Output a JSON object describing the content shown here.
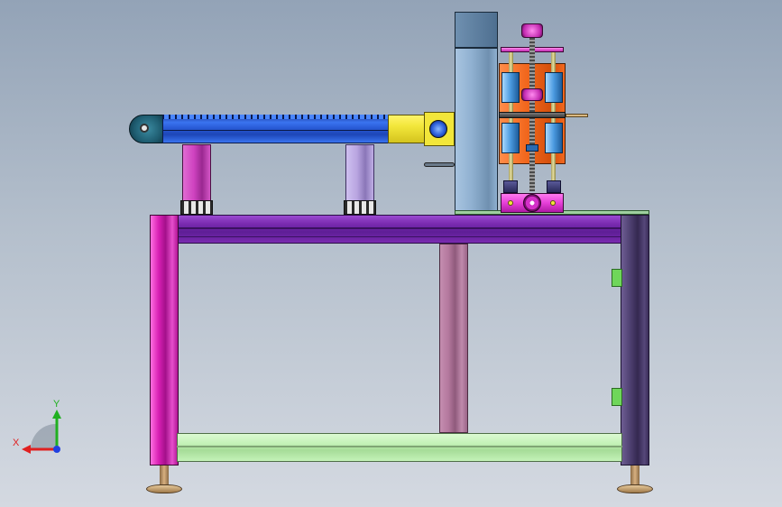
{
  "viewport": {
    "background_top": "#93a3b7",
    "background_bottom": "#d4d9e1"
  },
  "model": {
    "frame_left_post_color": "#d81fb4",
    "frame_right_post_color": "#4c3e6e",
    "top_beam_color": "#7a2bb0",
    "bottom_beam_color": "#c4f2b8",
    "center_post_color": "#b4799e",
    "conveyor_belt_color": "#2a5cd8",
    "conveyor_end_color": "#f2e63a",
    "leg_left_color": "#cf42c0",
    "leg_right_color": "#b8a4e0",
    "tower_color": "#8fb0d0",
    "lift_plate_color": "#f2681e",
    "lift_base_color": "#e63fd8",
    "bracket_color": "#6fd65a",
    "foot_color": "#b08a5a"
  },
  "triad": {
    "x_label": "X",
    "y_label": "Y",
    "x_color": "#e02020",
    "y_color": "#20b020",
    "z_color": "#2040e0"
  }
}
